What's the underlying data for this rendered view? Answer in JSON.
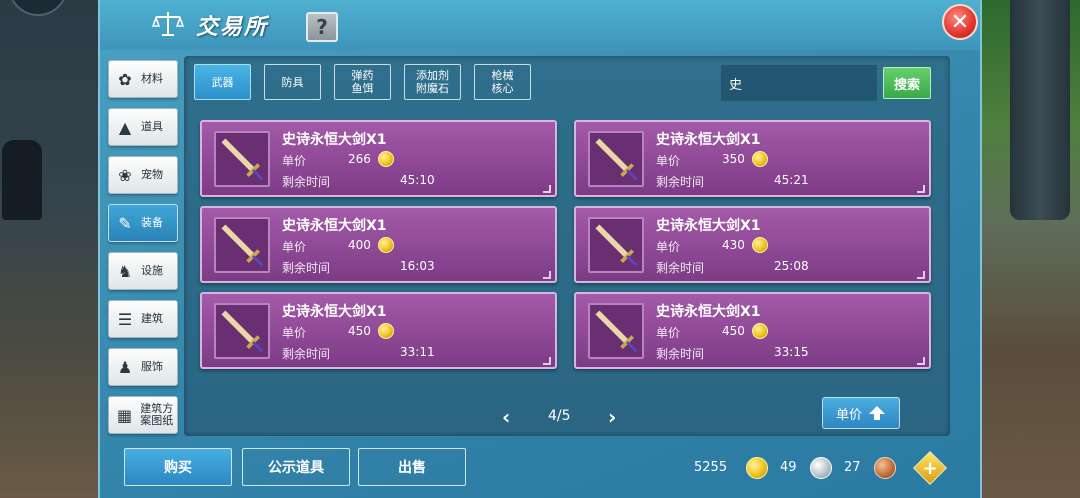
{
  "header": {
    "title": "交易所",
    "help_label": "?",
    "close_label": "✕"
  },
  "categories": [
    {
      "label": "材料",
      "icon": "materials-icon",
      "active": false
    },
    {
      "label": "道具",
      "icon": "flask-icon",
      "active": false
    },
    {
      "label": "宠物",
      "icon": "paw-icon",
      "active": false
    },
    {
      "label": "装备",
      "icon": "sword-icon",
      "active": true
    },
    {
      "label": "设施",
      "icon": "facility-icon",
      "active": false
    },
    {
      "label": "建筑",
      "icon": "building-icon",
      "active": false
    },
    {
      "label": "服饰",
      "icon": "clothing-icon",
      "active": false
    },
    {
      "label": "建筑方案图纸",
      "icon": "blueprint-icon",
      "active": false
    }
  ],
  "sub_tabs": [
    {
      "label": "武器",
      "active": true
    },
    {
      "label": "防具",
      "active": false
    },
    {
      "label": "弹药鱼饵",
      "active": false
    },
    {
      "label": "添加剂附魔石",
      "active": false
    },
    {
      "label": "枪械核心",
      "active": false
    }
  ],
  "search": {
    "value": "史",
    "button_label": "搜索"
  },
  "labels": {
    "price": "单价",
    "time_left": "剩余时间"
  },
  "items": [
    {
      "name": "史诗永恒大剑X1",
      "price": "266",
      "time": "45:10"
    },
    {
      "name": "史诗永恒大剑X1",
      "price": "350",
      "time": "45:21"
    },
    {
      "name": "史诗永恒大剑X1",
      "price": "400",
      "time": "16:03"
    },
    {
      "name": "史诗永恒大剑X1",
      "price": "430",
      "time": "25:08"
    },
    {
      "name": "史诗永恒大剑X1",
      "price": "450",
      "time": "33:11"
    },
    {
      "name": "史诗永恒大剑X1",
      "price": "450",
      "time": "33:15"
    }
  ],
  "pager": {
    "prev": "‹",
    "text": "4/5",
    "next": "›"
  },
  "sort_button": "单价",
  "bottom_buttons": {
    "buy": "购买",
    "publish": "公示道具",
    "sell": "出售"
  },
  "currency": {
    "gold": "5255",
    "silver": "49",
    "copper": "27"
  },
  "colors": {
    "panel": "#3d8eb2",
    "card": "#8e4a96",
    "accent_green": "#4cbc58",
    "close_red": "#e0352b"
  }
}
